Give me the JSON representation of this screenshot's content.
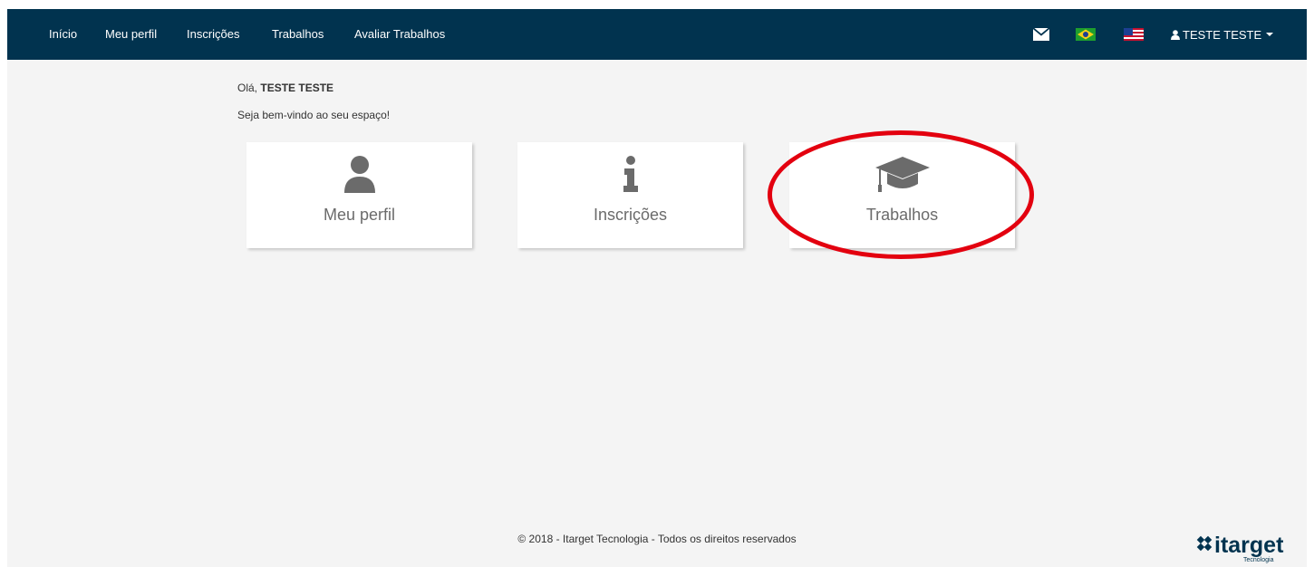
{
  "navbar": {
    "links": [
      "Início",
      "Meu perfil",
      "Inscrições",
      "Trabalhos",
      "Avaliar Trabalhos"
    ],
    "user_name": "TESTE TESTE",
    "icons": [
      "envelope-icon",
      "brazil-flag-icon",
      "usa-flag-icon",
      "user-icon",
      "caret-down-icon"
    ]
  },
  "main": {
    "greeting_prefix": "Olá,",
    "greeting_name": "TESTE TESTE",
    "welcome": "Seja bem-vindo ao seu espaço!",
    "cards": [
      {
        "label": "Meu perfil",
        "icon": "user-icon"
      },
      {
        "label": "Inscrições",
        "icon": "info-icon"
      },
      {
        "label": "Trabalhos",
        "icon": "graduation-cap-icon"
      }
    ],
    "highlighted_card": "Trabalhos"
  },
  "footer": {
    "copyright": "© 2018 - Itarget Tecnologia - Todos os direitos reservados",
    "logo_text": "itarget",
    "logo_subtext": "Tecnologia"
  },
  "colors": {
    "navbar_bg": "#01334f",
    "page_bg": "#f4f4f4",
    "highlight_ring": "#e3000f",
    "icon_gray": "#6b6b6b",
    "logo_color": "#01334f"
  }
}
